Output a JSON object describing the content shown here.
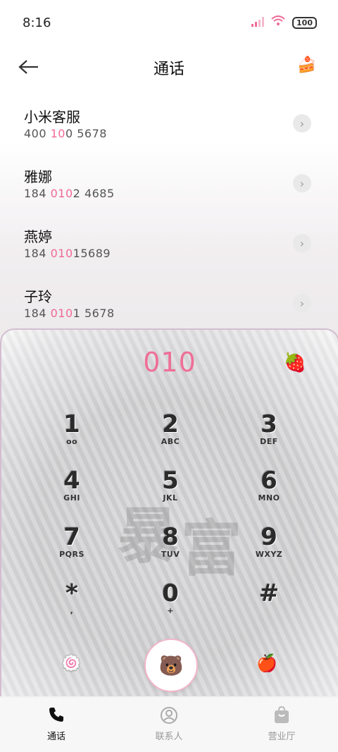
{
  "status_bar": {
    "time": "8:16",
    "battery": "100"
  },
  "header": {
    "title": "通话"
  },
  "contacts": [
    {
      "name": "小米客服",
      "number_parts": [
        "400 ",
        "10",
        "0 5678"
      ]
    },
    {
      "name": "雅娜",
      "number_parts": [
        "184 ",
        "010",
        "2 4685"
      ]
    },
    {
      "name": "燕婷",
      "number_parts": [
        "184 ",
        "010",
        "15689"
      ]
    },
    {
      "name": "子玲",
      "number_parts": [
        "184 ",
        "010",
        "1 5678"
      ]
    }
  ],
  "dialpad": {
    "display": "010",
    "keys": [
      {
        "digit": "1",
        "letters": "oo"
      },
      {
        "digit": "2",
        "letters": "ABC"
      },
      {
        "digit": "3",
        "letters": "DEF"
      },
      {
        "digit": "4",
        "letters": "GHI"
      },
      {
        "digit": "5",
        "letters": "JKL"
      },
      {
        "digit": "6",
        "letters": "MNO"
      },
      {
        "digit": "7",
        "letters": "PQRS"
      },
      {
        "digit": "8",
        "letters": "TUV"
      },
      {
        "digit": "9",
        "letters": "WXYZ"
      },
      {
        "digit": "*",
        "letters": ","
      },
      {
        "digit": "0",
        "letters": "+"
      },
      {
        "digit": "#",
        "letters": ""
      }
    ],
    "decor_text": [
      "暴",
      "富"
    ]
  },
  "tabs": [
    {
      "label": "通话",
      "icon": "phone-icon",
      "active": true
    },
    {
      "label": "联系人",
      "icon": "person-icon",
      "active": false
    },
    {
      "label": "营业厅",
      "icon": "bag-icon",
      "active": false
    }
  ],
  "colors": {
    "accent": "#ee6f97",
    "tab_active": "#111111",
    "tab_inactive": "#999999"
  }
}
